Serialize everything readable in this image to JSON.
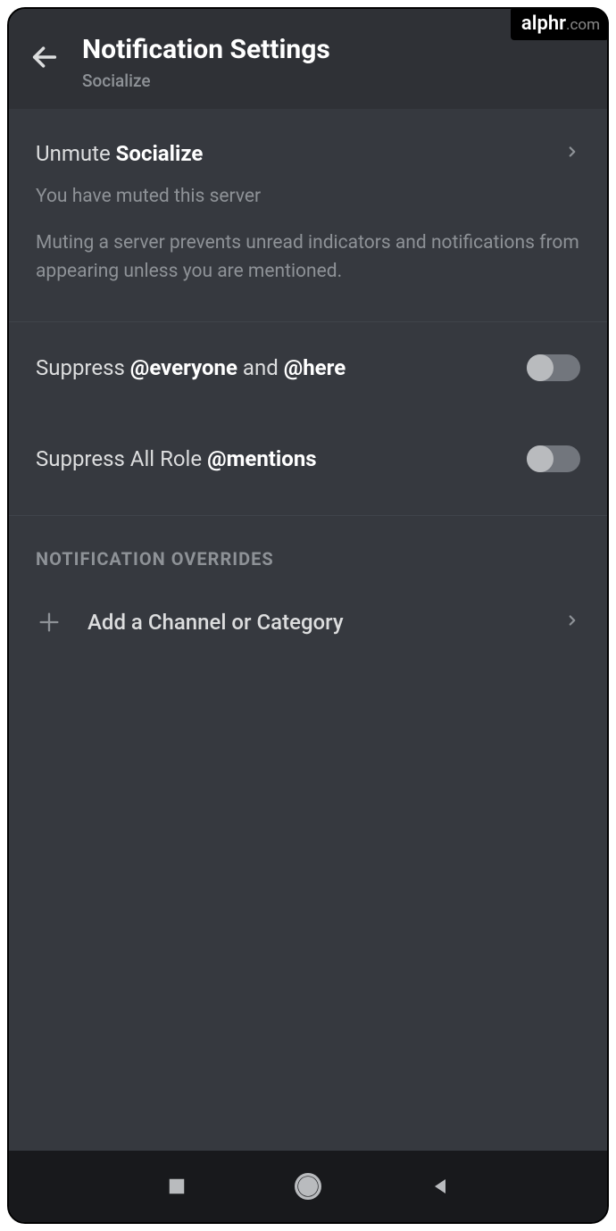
{
  "watermark": {
    "main": "alphr",
    "suffix": ".com"
  },
  "header": {
    "title": "Notification Settings",
    "subtitle": "Socialize"
  },
  "mute_section": {
    "unmute_prefix": "Unmute ",
    "server_name": "Socialize",
    "status_line": "You have muted this server",
    "description": "Muting a server prevents unread indicators and notifications from appearing unless you are mentioned."
  },
  "toggles": {
    "suppress_everyone": {
      "prefix": "Suppress ",
      "bold1": "@everyone",
      "mid": " and ",
      "bold2": "@here",
      "value": false
    },
    "suppress_roles": {
      "prefix": "Suppress All Role ",
      "bold1": "@mentions",
      "value": false
    }
  },
  "overrides": {
    "header": "NOTIFICATION OVERRIDES",
    "add_label": "Add a Channel or Category"
  }
}
